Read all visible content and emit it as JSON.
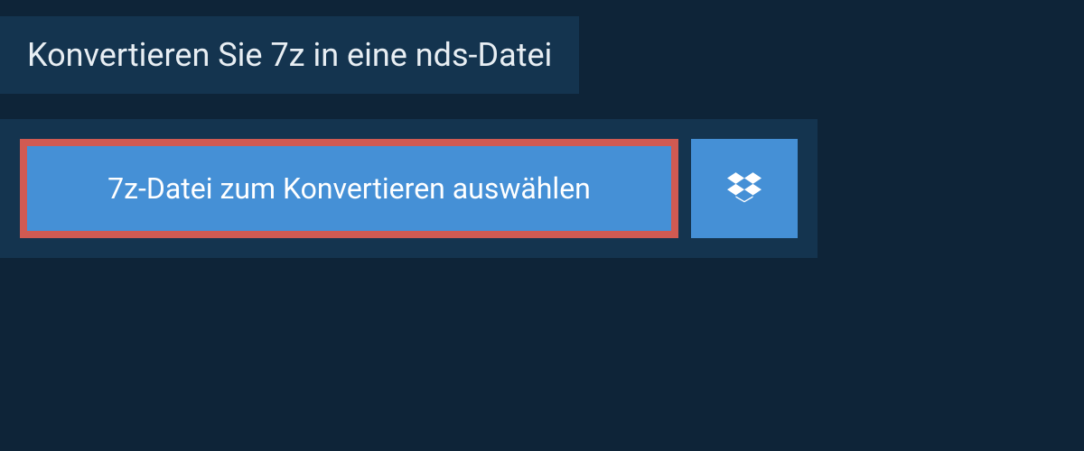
{
  "header": {
    "title": "Konvertieren Sie 7z in eine nds-Datei"
  },
  "actions": {
    "select_file_label": "7z-Datei zum Konvertieren auswählen",
    "dropbox_icon": "dropbox-icon"
  }
}
